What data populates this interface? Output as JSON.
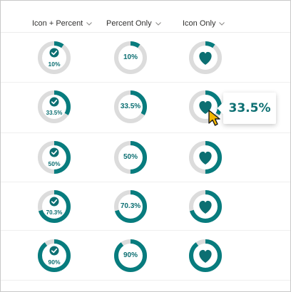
{
  "colors": {
    "accent": "#077c7e",
    "track": "#dcdcdc",
    "text": "#0c6f72",
    "cursor": "#f5b700"
  },
  "header": {
    "columns": [
      {
        "label": "Icon + Percent",
        "icon": "chevron-down-icon"
      },
      {
        "label": "Percent Only",
        "icon": "chevron-down-icon"
      },
      {
        "label": "Icon Only",
        "icon": "chevron-down-icon"
      }
    ]
  },
  "rows": [
    {
      "value": 0.1,
      "label": "10%"
    },
    {
      "value": 0.335,
      "label": "33.5%"
    },
    {
      "value": 0.5,
      "label": "50%"
    },
    {
      "value": 0.703,
      "label": "70.3%"
    },
    {
      "value": 0.9,
      "label": "90%"
    }
  ],
  "icons": {
    "icon_percent_column": "check-circle-icon",
    "icon_only_column": "heart-icon",
    "pointer": "mouse-pointer-icon"
  },
  "tooltip": {
    "text": "33.5%"
  }
}
